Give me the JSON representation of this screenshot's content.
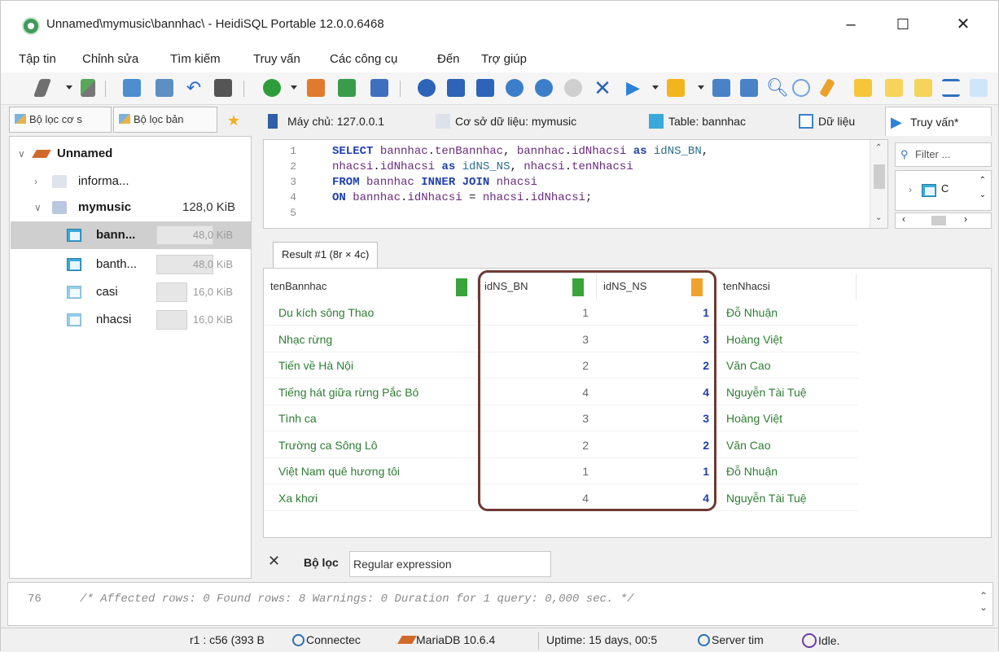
{
  "window": {
    "title": "Unnamed\\mymusic\\bannhac\\ - HeidiSQL Portable 12.0.0.6468",
    "minimize": "–",
    "maximize": "☐",
    "close": "✕"
  },
  "menu": [
    "Tập tin",
    "Chỉnh sửa",
    "Tìm kiếm",
    "Truy vấn",
    "Các công cụ",
    "Đến",
    "Trợ giúp"
  ],
  "left_tabs": [
    "Bộ lọc cơ s",
    "Bộ lọc bản"
  ],
  "tree": {
    "root": "Unnamed",
    "info_db": "informa...",
    "db": "mymusic",
    "db_size": "128,0 KiB",
    "tables": [
      {
        "name": "bann...",
        "size": "48,0 KiB"
      },
      {
        "name": "banth...",
        "size": "48,0 KiB"
      },
      {
        "name": "casi",
        "size": "16,0 KiB"
      },
      {
        "name": "nhacsi",
        "size": "16,0 KiB"
      }
    ]
  },
  "tabs": {
    "host": "Máy chủ: 127.0.0.1",
    "database": "Cơ sở dữ liệu: mymusic",
    "table": "Table: bannhac",
    "data": "Dữ liệu",
    "query": "Truy vấn*"
  },
  "editor": {
    "lines": [
      {
        "n": "1",
        "parts": [
          [
            "kw",
            "SELECT "
          ],
          [
            "id",
            "bannhac"
          ],
          [
            "p",
            "."
          ],
          [
            "id",
            "tenBannhac"
          ],
          [
            "p",
            ", "
          ],
          [
            "id",
            "bannhac"
          ],
          [
            "p",
            "."
          ],
          [
            "id",
            "idNhacsi"
          ],
          [
            "kw",
            " as "
          ],
          [
            "al",
            "idNS_BN"
          ],
          [
            "p",
            ","
          ]
        ]
      },
      {
        "n": "2",
        "parts": [
          [
            "id",
            "nhacsi"
          ],
          [
            "p",
            "."
          ],
          [
            "id",
            "idNhacsi"
          ],
          [
            "kw",
            " as "
          ],
          [
            "al",
            "idNS_NS"
          ],
          [
            "p",
            ", "
          ],
          [
            "id",
            "nhacsi"
          ],
          [
            "p",
            "."
          ],
          [
            "id",
            "tenNhacsi"
          ]
        ]
      },
      {
        "n": "3",
        "parts": [
          [
            "kw",
            "FROM "
          ],
          [
            "id",
            "bannhac"
          ],
          [
            "kw",
            " INNER JOIN "
          ],
          [
            "id",
            "nhacsi"
          ]
        ]
      },
      {
        "n": "4",
        "parts": [
          [
            "kw",
            "ON "
          ],
          [
            "id",
            "bannhac"
          ],
          [
            "p",
            "."
          ],
          [
            "id",
            "idNhacsi"
          ],
          [
            "p",
            " = "
          ],
          [
            "id",
            "nhacsi"
          ],
          [
            "p",
            "."
          ],
          [
            "id",
            "idNhacsi"
          ],
          [
            "p",
            ";"
          ]
        ]
      },
      {
        "n": "5",
        "parts": []
      }
    ]
  },
  "filter_placeholder": "Filter ...",
  "result_tab": "Result #1 (8r × 4c)",
  "grid": {
    "columns": [
      "tenBannhac",
      "idNS_BN",
      "idNS_NS",
      "tenNhacsi"
    ],
    "rows": [
      [
        "Du kích sông Thao",
        "1",
        "1",
        "Đỗ Nhuận"
      ],
      [
        "Nhạc rừng",
        "3",
        "3",
        "Hoàng Việt"
      ],
      [
        "Tiến về Hà Nội",
        "2",
        "2",
        "Văn Cao"
      ],
      [
        "Tiếng hát giữa rừng Pắc Bó",
        "4",
        "4",
        "Nguyễn Tài Tuệ"
      ],
      [
        "Tình ca",
        "3",
        "3",
        "Hoàng Việt"
      ],
      [
        "Trường ca Sông Lô",
        "2",
        "2",
        "Văn Cao"
      ],
      [
        "Việt Nam quê hương tôi",
        "1",
        "1",
        "Đỗ Nhuận"
      ],
      [
        "Xa khơi",
        "4",
        "4",
        "Nguyễn Tài Tuệ"
      ]
    ]
  },
  "filterbar": {
    "close": "✕",
    "label": "Bộ lọc",
    "value": "Regular expression"
  },
  "log": {
    "line": "76",
    "message": "/* Affected rows: 0  Found rows: 8  Warnings: 0  Duration for 1 query: 0,000 sec. */"
  },
  "status": {
    "pos": "r1 : c56 (393 B",
    "conn": "Connectec",
    "server": "MariaDB 10.6.4",
    "uptime": "Uptime: 15 days, 00:5",
    "server_time": "Server tim",
    "state": "Idle."
  },
  "colors": {
    "name_green": "#2e7d32",
    "num_blue": "#1f3fae",
    "highlight": "#6d3a34"
  }
}
